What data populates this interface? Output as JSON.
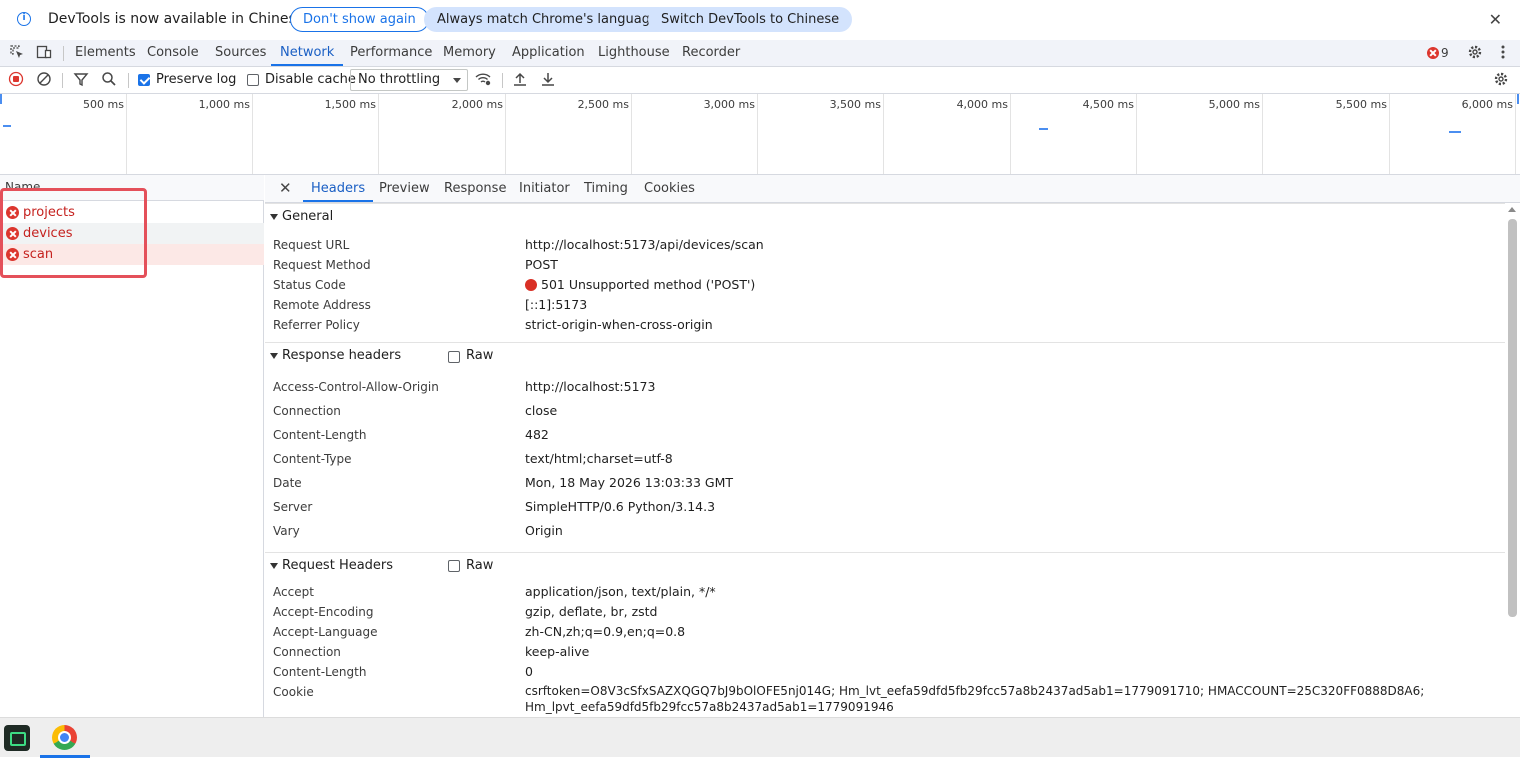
{
  "infobar": {
    "message": "DevTools is now available in Chinese",
    "btn_dont_show": "Don't show again",
    "btn_match": "Always match Chrome's language",
    "btn_switch": "Switch DevTools to Chinese",
    "close": "✕"
  },
  "tabs": [
    "Elements",
    "Console",
    "Sources",
    "Network",
    "Performance",
    "Memory",
    "Application",
    "Lighthouse",
    "Recorder"
  ],
  "active_tab": "Network",
  "error_count": "9",
  "toolbar": {
    "preserve_log": "Preserve log",
    "preserve_log_checked": true,
    "disable_cache": "Disable cache",
    "disable_cache_checked": false,
    "throttling": "No throttling"
  },
  "timeline_ticks": [
    "500 ms",
    "1,000 ms",
    "1,500 ms",
    "2,000 ms",
    "2,500 ms",
    "3,000 ms",
    "3,500 ms",
    "4,000 ms",
    "4,500 ms",
    "5,000 ms",
    "5,500 ms",
    "6,000 ms"
  ],
  "request_list": {
    "header": "Name",
    "items": [
      "projects",
      "devices",
      "scan"
    ]
  },
  "details": {
    "tabs": [
      "Headers",
      "Preview",
      "Response",
      "Initiator",
      "Timing",
      "Cookies"
    ],
    "active_tab": "Headers",
    "general": {
      "title": "General",
      "rows": [
        {
          "k": "Request URL",
          "v": "http://localhost:5173/api/devices/scan"
        },
        {
          "k": "Request Method",
          "v": "POST"
        },
        {
          "k": "Status Code",
          "v": "501 Unsupported method ('POST')"
        },
        {
          "k": "Remote Address",
          "v": "[::1]:5173"
        },
        {
          "k": "Referrer Policy",
          "v": "strict-origin-when-cross-origin"
        }
      ]
    },
    "response_headers": {
      "title": "Response headers",
      "raw": "Raw",
      "rows": [
        {
          "k": "Access-Control-Allow-Origin",
          "v": "http://localhost:5173"
        },
        {
          "k": "Connection",
          "v": "close"
        },
        {
          "k": "Content-Length",
          "v": "482"
        },
        {
          "k": "Content-Type",
          "v": "text/html;charset=utf-8"
        },
        {
          "k": "Date",
          "v": "Mon, 18 May 2026 13:03:33 GMT"
        },
        {
          "k": "Server",
          "v": "SimpleHTTP/0.6 Python/3.14.3"
        },
        {
          "k": "Vary",
          "v": "Origin"
        }
      ]
    },
    "request_headers": {
      "title": "Request Headers",
      "raw": "Raw",
      "rows": [
        {
          "k": "Accept",
          "v": "application/json, text/plain, */*"
        },
        {
          "k": "Accept-Encoding",
          "v": "gzip, deflate, br, zstd"
        },
        {
          "k": "Accept-Language",
          "v": "zh-CN,zh;q=0.9,en;q=0.8"
        },
        {
          "k": "Connection",
          "v": "keep-alive"
        },
        {
          "k": "Content-Length",
          "v": "0"
        },
        {
          "k": "Cookie",
          "v": "csrftoken=O8V3cSfxSAZXQGQ7bJ9bOlOFE5nj014G; Hm_lvt_eefa59dfd5fb29fcc57a8b2437ad5ab1=1779091710; HMACCOUNT=25C320FF0888D8A6;"
        },
        {
          "k": "",
          "v": "Hm_lpvt_eefa59dfd5fb29fcc57a8b2437ad5ab1=1779091946"
        }
      ]
    }
  },
  "colors": {
    "accent": "#1a73e8",
    "error": "#d93025",
    "highlight": "#e4505a"
  }
}
